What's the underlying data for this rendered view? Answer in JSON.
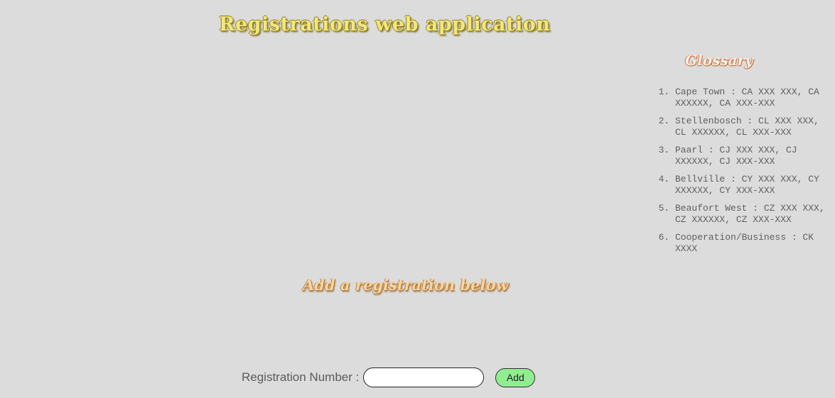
{
  "header": {
    "title": "Registrations web application"
  },
  "glossary": {
    "title": "Glossary",
    "items": [
      "Cape Town : CA XXX XXX, CA XXXXXX, CA XXX-XXX",
      "Stellenbosch : CL XXX XXX, CL XXXXXX, CL XXX-XXX",
      "Paarl : CJ XXX XXX, CJ XXXXXX, CJ XXX-XXX",
      "Bellville : CY XXX XXX, CY XXXXXX, CY XXX-XXX",
      "Beaufort West : CZ XXX XXX, CZ XXXXXX, CZ XXX-XXX",
      "Cooperation/Business : CK XXXX"
    ]
  },
  "main": {
    "add_heading": "Add a registration below"
  },
  "form": {
    "label": "Registration Number :",
    "input_value": "",
    "button_label": "Add"
  },
  "colors": {
    "background": "#dcdcdc",
    "title_fill": "#f2e879",
    "button_fill": "#90ee90"
  }
}
